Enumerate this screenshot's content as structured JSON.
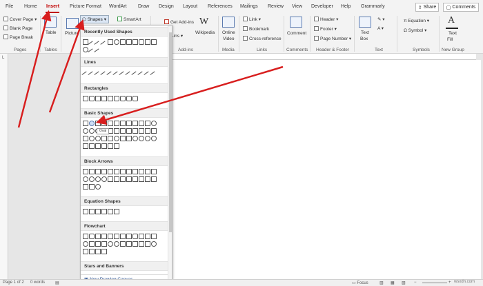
{
  "tabs": [
    "File",
    "Home",
    "Insert",
    "Picture Format",
    "WordArt",
    "Draw",
    "Design",
    "Layout",
    "References",
    "Mailings",
    "Review",
    "View",
    "Developer",
    "Help",
    "Grammarly"
  ],
  "share_label": "Share",
  "comments_label": "Comments",
  "ribbon": {
    "pages": {
      "items": [
        "Cover Page",
        "Blank Page",
        "Page Break"
      ],
      "group_label": "Pages"
    },
    "tables": {
      "label": "Table",
      "group_label": "Tables"
    },
    "illustrations": {
      "pictures": "Picture",
      "shapes": "Shapes",
      "smartart": "SmartArt"
    },
    "addins": {
      "get": "Get Add-ins",
      "my": "Add-ins",
      "group_label": "Add-ins"
    },
    "wikipedia": "Wikipedia",
    "media": {
      "label1": "Online",
      "label2": "Video",
      "group_label": "Media"
    },
    "links": {
      "items": [
        "Link",
        "Bookmark",
        "Cross-reference"
      ],
      "group_label": "Links"
    },
    "comments": {
      "label": "Comment",
      "group_label": "Comments"
    },
    "header_footer": {
      "items": [
        "Header",
        "Footer",
        "Page Number"
      ],
      "group_label": "Header & Footer"
    },
    "text": {
      "label1": "Text",
      "label2": "Box",
      "group_label": "Text"
    },
    "symbols": {
      "items": [
        "Equation",
        "Symbol"
      ],
      "group_label": "Symbols"
    },
    "newgroup": {
      "label1": "Text",
      "label2": "Fill",
      "group_label": "New Group"
    }
  },
  "panel": {
    "categories": [
      "Recently Used Shapes",
      "Lines",
      "Rectangles",
      "Basic Shapes",
      "Block Arrows",
      "Equation Shapes",
      "Flowchart",
      "Stars and Banners"
    ],
    "tooltip": "Oval",
    "new_canvas": "New Drawing Canvas"
  },
  "status": {
    "page": "Page 1 of 2",
    "words": "0 words",
    "focus": "Focus"
  },
  "watermark": "wsxdn.com",
  "colors": {
    "accent": "#c00000",
    "arrow": "#d81e1e"
  }
}
